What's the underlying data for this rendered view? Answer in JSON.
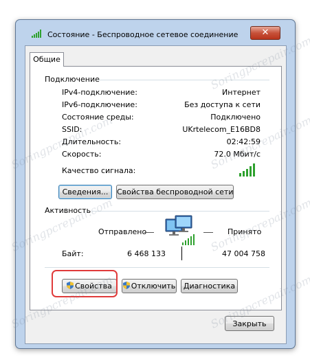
{
  "window": {
    "title": "Состояние - Беспроводное сетевое соединение",
    "close_label": "✕"
  },
  "tabs": [
    {
      "label": "Общие"
    }
  ],
  "connection": {
    "section_title": "Подключение",
    "rows": [
      {
        "label": "IPv4-подключение:",
        "value": "Интернет"
      },
      {
        "label": "IPv6-подключение:",
        "value": "Без доступа к сети"
      },
      {
        "label": "Состояние среды:",
        "value": "Подключено"
      },
      {
        "label": "SSID:",
        "value": "UKrtelecom_E16BD8"
      },
      {
        "label": "Длительность:",
        "value": "02:42:59"
      },
      {
        "label": "Скорость:",
        "value": "72.0 Мбит/с"
      }
    ],
    "signal_label": "Качество сигнала:",
    "signal_bars": 5,
    "details_button": "Сведения...",
    "wireless_props_button": "Свойства беспроводной сети"
  },
  "activity": {
    "section_title": "Активность",
    "sent_label": "Отправлено",
    "received_label": "Принято",
    "bytes_label": "Байт:",
    "bytes_sent": "6 468 133",
    "bytes_received": "47 004 758"
  },
  "actions": {
    "properties_button": "Свойства",
    "disable_button": "Отключить",
    "diagnose_button": "Диагностика",
    "close_button": "Закрыть"
  },
  "watermark": "Soringpcrepair.com",
  "colors": {
    "signal_green": "#2ea12e",
    "highlight_red": "#e03a3a",
    "frame": "#bed3ec"
  }
}
